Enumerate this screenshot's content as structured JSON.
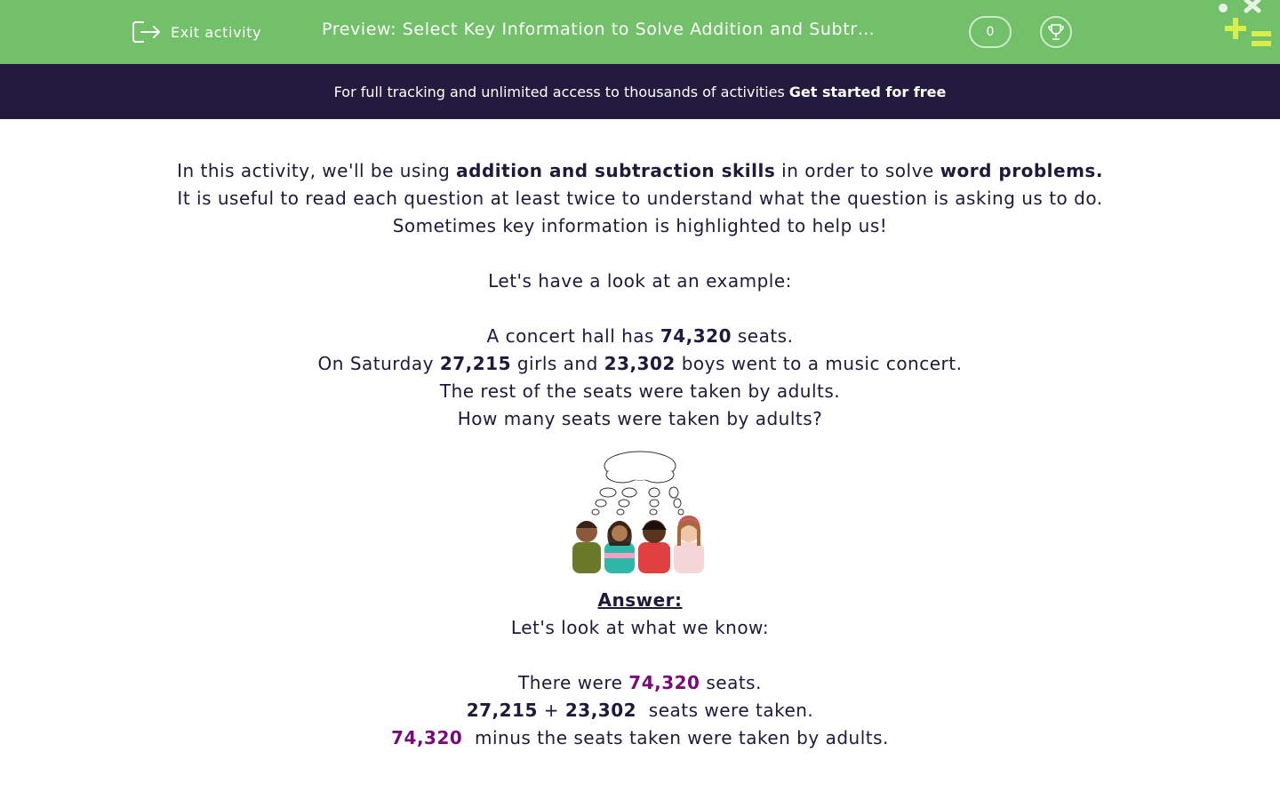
{
  "header": {
    "exit_label": "Exit activity",
    "title": "Preview: Select Key Information to Solve Addition and Subtraction Word Problems",
    "score": "0"
  },
  "banner": {
    "text": "For full tracking and unlimited access to thousands of activities",
    "cta": "Get started for free"
  },
  "intro": {
    "l1_a": "In this activity, we'll be using ",
    "l1_b": "addition and subtraction skills",
    "l1_c": " in order to solve ",
    "l1_d": "word problems.",
    "l2": "It is useful to read each question at least twice to understand what the question is asking us to do.",
    "l3": "Sometimes key information is highlighted to help us!",
    "l4": "Let's have a look at an example:"
  },
  "example": {
    "l1_a": "A concert hall has ",
    "l1_b": "74,320",
    "l1_c": " seats.",
    "l2_a": "On Saturday ",
    "l2_b": "27,215",
    "l2_c": " girls and ",
    "l2_d": "23,302",
    "l2_e": " boys went to a music concert.",
    "l3": "The rest of the seats were taken by adults.",
    "l4": "How many seats were taken by adults?"
  },
  "answer": {
    "heading": "Answer:",
    "intro": "Let's look at what we know:",
    "l1_a": "There were ",
    "l1_b": "74,320",
    "l1_c": " seats.",
    "l2_a": "27,215",
    "l2_b": " + ",
    "l2_c": "23,302",
    "l2_d": "  seats were taken.",
    "l3_a": "74,320",
    "l3_b": "  minus the seats taken were taken by adults."
  },
  "colors": {
    "header_green": "#72c06a",
    "banner_navy": "#231b3d",
    "highlight_purple": "#7a0a7a",
    "text": "#1e1a3a"
  },
  "icons": [
    "exit-icon",
    "trophy-icon",
    "maths-logo",
    "thinking-children-illustration"
  ]
}
